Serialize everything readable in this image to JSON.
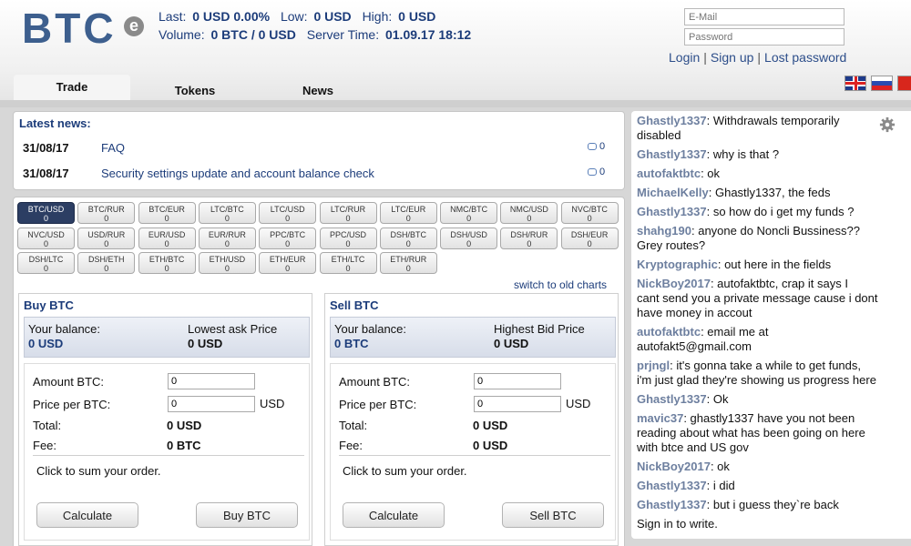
{
  "header": {
    "logo_text": "BTC",
    "logo_badge": "e",
    "stats": {
      "last_label": "Last:",
      "last_value": "0 USD 0.00%",
      "low_label": "Low:",
      "low_value": "0 USD",
      "high_label": "High:",
      "high_value": "0 USD",
      "volume_label": "Volume:",
      "volume_value": "0 BTC / 0 USD",
      "server_time_label": "Server Time:",
      "server_time_value": "01.09.17 18:12"
    },
    "login": {
      "email_placeholder": "E-Mail",
      "password_placeholder": "Password",
      "login_link": "Login",
      "signup_link": "Sign up",
      "lost_password_link": "Lost password"
    },
    "tabs": [
      {
        "label": "Trade",
        "active": true
      },
      {
        "label": "Tokens",
        "active": false
      },
      {
        "label": "News",
        "active": false
      }
    ],
    "languages": [
      "en",
      "ru",
      "cn"
    ]
  },
  "news": {
    "title": "Latest news:",
    "items": [
      {
        "date": "31/08/17",
        "title": "FAQ",
        "comments": "0"
      },
      {
        "date": "31/08/17",
        "title": "Security settings update and account balance check",
        "comments": "0"
      }
    ]
  },
  "pairs": [
    {
      "name": "BTC/USD",
      "value": "0",
      "active": true
    },
    {
      "name": "BTC/RUR",
      "value": "0"
    },
    {
      "name": "BTC/EUR",
      "value": "0"
    },
    {
      "name": "LTC/BTC",
      "value": "0"
    },
    {
      "name": "LTC/USD",
      "value": "0"
    },
    {
      "name": "LTC/RUR",
      "value": "0"
    },
    {
      "name": "LTC/EUR",
      "value": "0"
    },
    {
      "name": "NMC/BTC",
      "value": "0"
    },
    {
      "name": "NMC/USD",
      "value": "0"
    },
    {
      "name": "NVC/BTC",
      "value": "0"
    },
    {
      "name": "NVC/USD",
      "value": "0"
    },
    {
      "name": "USD/RUR",
      "value": "0"
    },
    {
      "name": "EUR/USD",
      "value": "0"
    },
    {
      "name": "EUR/RUR",
      "value": "0"
    },
    {
      "name": "PPC/BTC",
      "value": "0"
    },
    {
      "name": "PPC/USD",
      "value": "0"
    },
    {
      "name": "DSH/BTC",
      "value": "0"
    },
    {
      "name": "DSH/USD",
      "value": "0"
    },
    {
      "name": "DSH/RUR",
      "value": "0"
    },
    {
      "name": "DSH/EUR",
      "value": "0"
    },
    {
      "name": "DSH/LTC",
      "value": "0"
    },
    {
      "name": "DSH/ETH",
      "value": "0"
    },
    {
      "name": "ETH/BTC",
      "value": "0"
    },
    {
      "name": "ETH/USD",
      "value": "0"
    },
    {
      "name": "ETH/EUR",
      "value": "0"
    },
    {
      "name": "ETH/LTC",
      "value": "0"
    },
    {
      "name": "ETH/RUR",
      "value": "0"
    }
  ],
  "switch_charts": "switch to old charts",
  "buy": {
    "title": "Buy BTC",
    "balance_label": "Your balance:",
    "balance_value": "0 USD",
    "price_label": "Lowest ask Price",
    "price_value": "0 USD",
    "amount_label": "Amount BTC:",
    "amount_value": "0",
    "price_per_label": "Price per BTC:",
    "price_per_value": "0",
    "price_unit": "USD",
    "total_label": "Total:",
    "total_value": "0 USD",
    "fee_label": "Fee:",
    "fee_value": "0 BTC",
    "hint": "Click to sum your order.",
    "calculate_button": "Calculate",
    "action_button": "Buy BTC"
  },
  "sell": {
    "title": "Sell BTC",
    "balance_label": "Your balance:",
    "balance_value": "0 BTC",
    "price_label": "Highest Bid Price",
    "price_value": "0 USD",
    "amount_label": "Amount BTC:",
    "amount_value": "0",
    "price_per_label": "Price per BTC:",
    "price_per_value": "0",
    "price_unit": "USD",
    "total_label": "Total:",
    "total_value": "0 USD",
    "fee_label": "Fee:",
    "fee_value": "0 USD",
    "hint": "Click to sum your order.",
    "calculate_button": "Calculate",
    "action_button": "Sell BTC"
  },
  "chat": {
    "messages": [
      {
        "nick": "Ghastly1337",
        "text": ": Withdrawals temporarily",
        "cont": "disabled"
      },
      {
        "nick": "Ghastly1337",
        "text": ": why is that ?"
      },
      {
        "nick": "autofaktbtc",
        "text": ": ok"
      },
      {
        "nick": "MichaelKelly",
        "text": ": Ghastly1337, the feds"
      },
      {
        "nick": "Ghastly1337",
        "text": ": so how do i get my funds ?"
      },
      {
        "nick": "shahg190",
        "text": ": anyone do Noncli Bussiness??",
        "cont": "Grey routes?"
      },
      {
        "nick": "Kryptographic",
        "text": ": out here in the fields"
      },
      {
        "nick": "NickBoy2017",
        "text": ": autofaktbtc, crap it says I",
        "cont": "cant send you a private message cause i dont",
        "cont2": "have money in accout"
      },
      {
        "nick": "autofaktbtc",
        "text": ": email me at",
        "cont": "autofakt5@gmail.com"
      },
      {
        "nick": "prjngl",
        "text": ": it's gonna take a while to get funds,",
        "cont": "i'm just glad they're showing us progress here"
      },
      {
        "nick": "Ghastly1337",
        "text": ": Ok"
      },
      {
        "nick": "mavic37",
        "text": ": ghastly1337 have you not been",
        "cont": "reading about what has been going on here",
        "cont2": "with btce and US gov"
      },
      {
        "nick": "NickBoy2017",
        "text": ": ok"
      },
      {
        "nick": "Ghastly1337",
        "text": ": i did"
      },
      {
        "nick": "Ghastly1337",
        "text": ": but i guess they`re back"
      }
    ],
    "sign_in_prompt": "Sign in to write."
  }
}
